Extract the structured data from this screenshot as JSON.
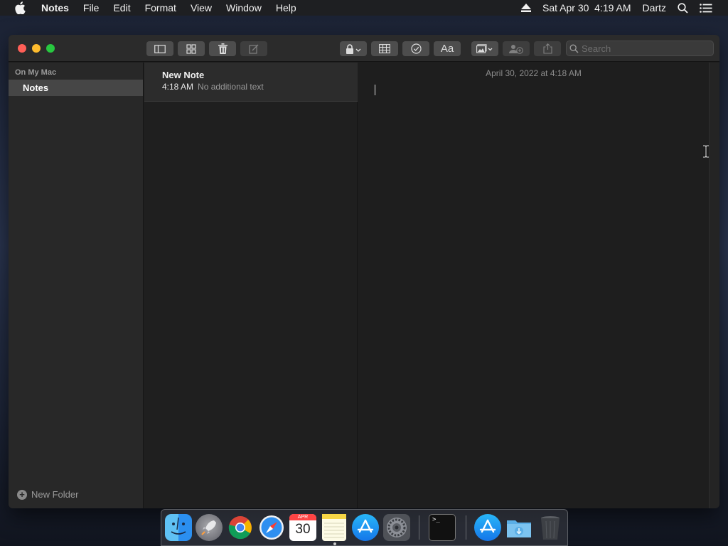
{
  "menubar": {
    "app_name": "Notes",
    "items": [
      "File",
      "Edit",
      "Format",
      "View",
      "Window",
      "Help"
    ],
    "clock": "Sat Apr 30  4:19 AM",
    "user": "Dartz",
    "icons": [
      "apple-logo-icon",
      "eject-icon",
      "spotlight-search-icon",
      "notification-center-icon"
    ]
  },
  "toolbar": {
    "buttons": [
      "sidebar-toggle-icon",
      "gallery-view-icon",
      "trash-icon",
      "compose-icon",
      "lock-icon",
      "table-icon",
      "checklist-icon",
      "format-text-icon",
      "media-icon",
      "collaborate-icon",
      "share-icon"
    ],
    "format_label": "Aa",
    "search_placeholder": "Search"
  },
  "sidebar": {
    "section_title": "On My Mac",
    "folders": [
      {
        "label": "Notes",
        "selected": true
      }
    ],
    "new_folder_label": "New Folder"
  },
  "notelist": {
    "notes": [
      {
        "title": "New Note",
        "time": "4:18 AM",
        "preview": "No additional text",
        "selected": true
      }
    ]
  },
  "editor": {
    "date": "April 30, 2022 at 4:18 AM",
    "content": ""
  },
  "dock": {
    "apps": [
      "Finder",
      "Launchpad",
      "Google Chrome",
      "Safari",
      "Calendar",
      "Notes",
      "App Store",
      "System Preferences",
      "Terminal",
      "App Store Downloads",
      "Downloads Folder",
      "Trash"
    ],
    "calendar_month": "APR",
    "calendar_day": "30",
    "terminal_prompt": ">_"
  },
  "colors": {
    "close": "#ff5f57",
    "minimize": "#febc2e",
    "zoom": "#28c840",
    "selected_folder": "#464646"
  }
}
